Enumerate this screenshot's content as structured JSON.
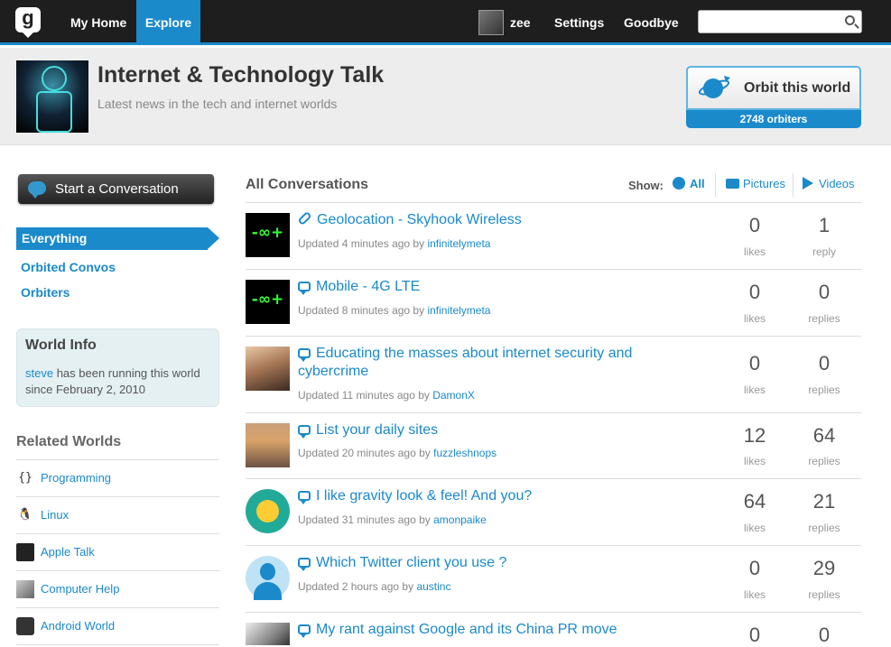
{
  "nav": {
    "home": "My Home",
    "explore": "Explore",
    "user": "zee",
    "settings": "Settings",
    "goodbye": "Goodbye",
    "search_placeholder": "",
    "logo": "g"
  },
  "world": {
    "title": "Internet & Technology Talk",
    "subtitle": "Latest news in the tech and internet worlds",
    "orbit_label": "Orbit this world",
    "orbiters": "2748 orbiters"
  },
  "sidebar": {
    "start_label": "Start a Conversation",
    "items": [
      {
        "label": "Everything",
        "active": true
      },
      {
        "label": "Orbited Convos",
        "active": false
      },
      {
        "label": "Orbiters",
        "active": false
      }
    ],
    "info": {
      "heading": "World Info",
      "owner": "steve",
      "text": " has been running this world since February 2, 2010"
    },
    "related_heading": "Related Worlds",
    "related": [
      {
        "label": "Programming",
        "icon": "curly-braces-icon",
        "glyph": "{}"
      },
      {
        "label": "Linux",
        "icon": "penguin-icon",
        "glyph": "🐧"
      },
      {
        "label": "Apple Talk",
        "icon": "apple-icon",
        "glyph": ""
      },
      {
        "label": "Computer Help",
        "icon": "computer-icon",
        "glyph": "▣"
      },
      {
        "label": "Android World",
        "icon": "android-icon",
        "glyph": "▤"
      }
    ]
  },
  "main": {
    "heading": "All Conversations",
    "show_label": "Show:",
    "filters": {
      "all": "All",
      "pictures": "Pictures",
      "videos": "Videos"
    },
    "conversations": [
      {
        "title": "Geolocation - Skyhook Wireless",
        "type": "link",
        "updated": "Updated 4 minutes ago by ",
        "user": "infinitelymeta",
        "likes": "0",
        "likes_label": "likes",
        "replies": "1",
        "replies_label": "reply"
      },
      {
        "title": "Mobile - 4G LTE",
        "type": "chat",
        "updated": "Updated 8 minutes ago by ",
        "user": "infinitelymeta",
        "likes": "0",
        "likes_label": "likes",
        "replies": "0",
        "replies_label": "replies"
      },
      {
        "title": "Educating the masses about internet security and cybercrime",
        "type": "chat",
        "updated": "Updated 11 minutes ago by ",
        "user": "DamonX",
        "likes": "0",
        "likes_label": "likes",
        "replies": "0",
        "replies_label": "replies"
      },
      {
        "title": "List your daily sites",
        "type": "chat",
        "updated": "Updated 20 minutes ago by ",
        "user": "fuzzleshnops",
        "likes": "12",
        "likes_label": "likes",
        "replies": "64",
        "replies_label": "replies"
      },
      {
        "title": "I like gravity look & feel! And you?",
        "type": "chat",
        "updated": "Updated 31 minutes ago by ",
        "user": "amonpaike",
        "likes": "64",
        "likes_label": "likes",
        "replies": "21",
        "replies_label": "replies"
      },
      {
        "title": "Which Twitter client you use ?",
        "type": "chat",
        "updated": "Updated 2 hours ago by ",
        "user": "austinc",
        "likes": "0",
        "likes_label": "likes",
        "replies": "29",
        "replies_label": "replies"
      },
      {
        "title": "My rant against Google and its China PR move",
        "type": "chat",
        "likes": "0",
        "replies": "0"
      }
    ]
  },
  "colors": {
    "accent": "#1a8acb",
    "nav_bg": "#1e1e1e"
  }
}
